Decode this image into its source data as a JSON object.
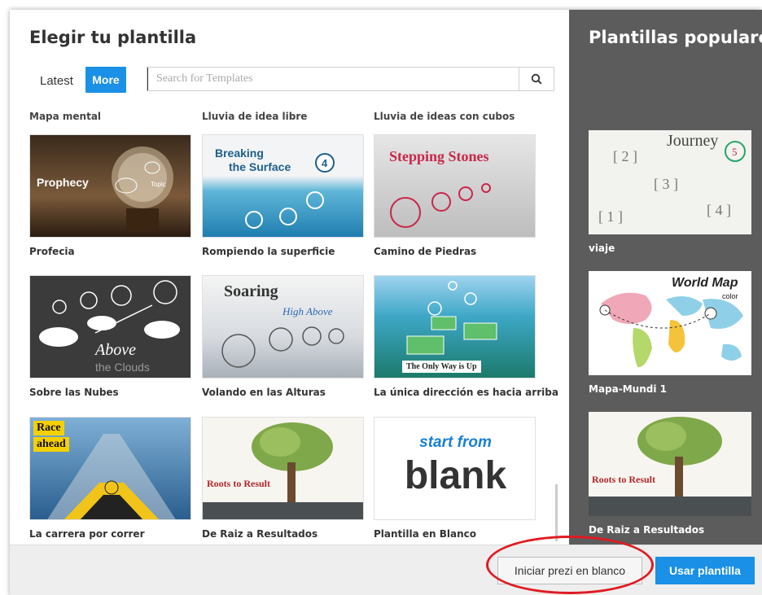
{
  "dialog": {
    "title": "Elegir tu plantilla",
    "tabs": {
      "latest": "Latest",
      "more": "More"
    },
    "search_placeholder": "Search for Templates",
    "partial_labels": [
      "Mapa mental",
      "Lluvia de idea libre",
      "Lluvia de ideas con cubos"
    ],
    "templates": [
      {
        "label": "Profecia",
        "thumb_text": "Prophecy",
        "thumb_sub": "Topic"
      },
      {
        "label": "Rompiendo la superficie",
        "thumb_text": "Breaking",
        "thumb_sub": "the Surface"
      },
      {
        "label": "Camino de Piedras",
        "thumb_text": "Stepping Stones"
      },
      {
        "label": "Sobre las Nubes",
        "thumb_text": "Above",
        "thumb_sub": "the Clouds"
      },
      {
        "label": "Volando en las Alturas",
        "thumb_text": "Soaring",
        "thumb_sub": "High Above"
      },
      {
        "label": "La única dirección es hacia arriba",
        "thumb_text": "The Only Way is Up"
      },
      {
        "label": "La carrera por correr",
        "thumb_text": "Race",
        "thumb_sub": "ahead"
      },
      {
        "label": "De Raiz a Resultados",
        "thumb_text": "Roots to Result"
      },
      {
        "label": "Plantilla en Blanco",
        "thumb_text": "start from",
        "thumb_sub": "blank"
      }
    ],
    "footer": {
      "blank_button": "Iniciar prezi en blanco",
      "use_button": "Usar plantilla"
    }
  },
  "popular": {
    "title": "Plantillas populares",
    "items": [
      {
        "label": "viaje",
        "thumb_text": "Journey"
      },
      {
        "label": "Mapa-Mundi 1",
        "thumb_text": "World Map",
        "thumb_sub": "color"
      },
      {
        "label": "De Raiz a Resultados",
        "thumb_text": "Roots to Result"
      }
    ]
  },
  "colors": {
    "accent": "#1a90e6",
    "sidebar": "#5c5c5c",
    "highlight": "#e01b22"
  }
}
